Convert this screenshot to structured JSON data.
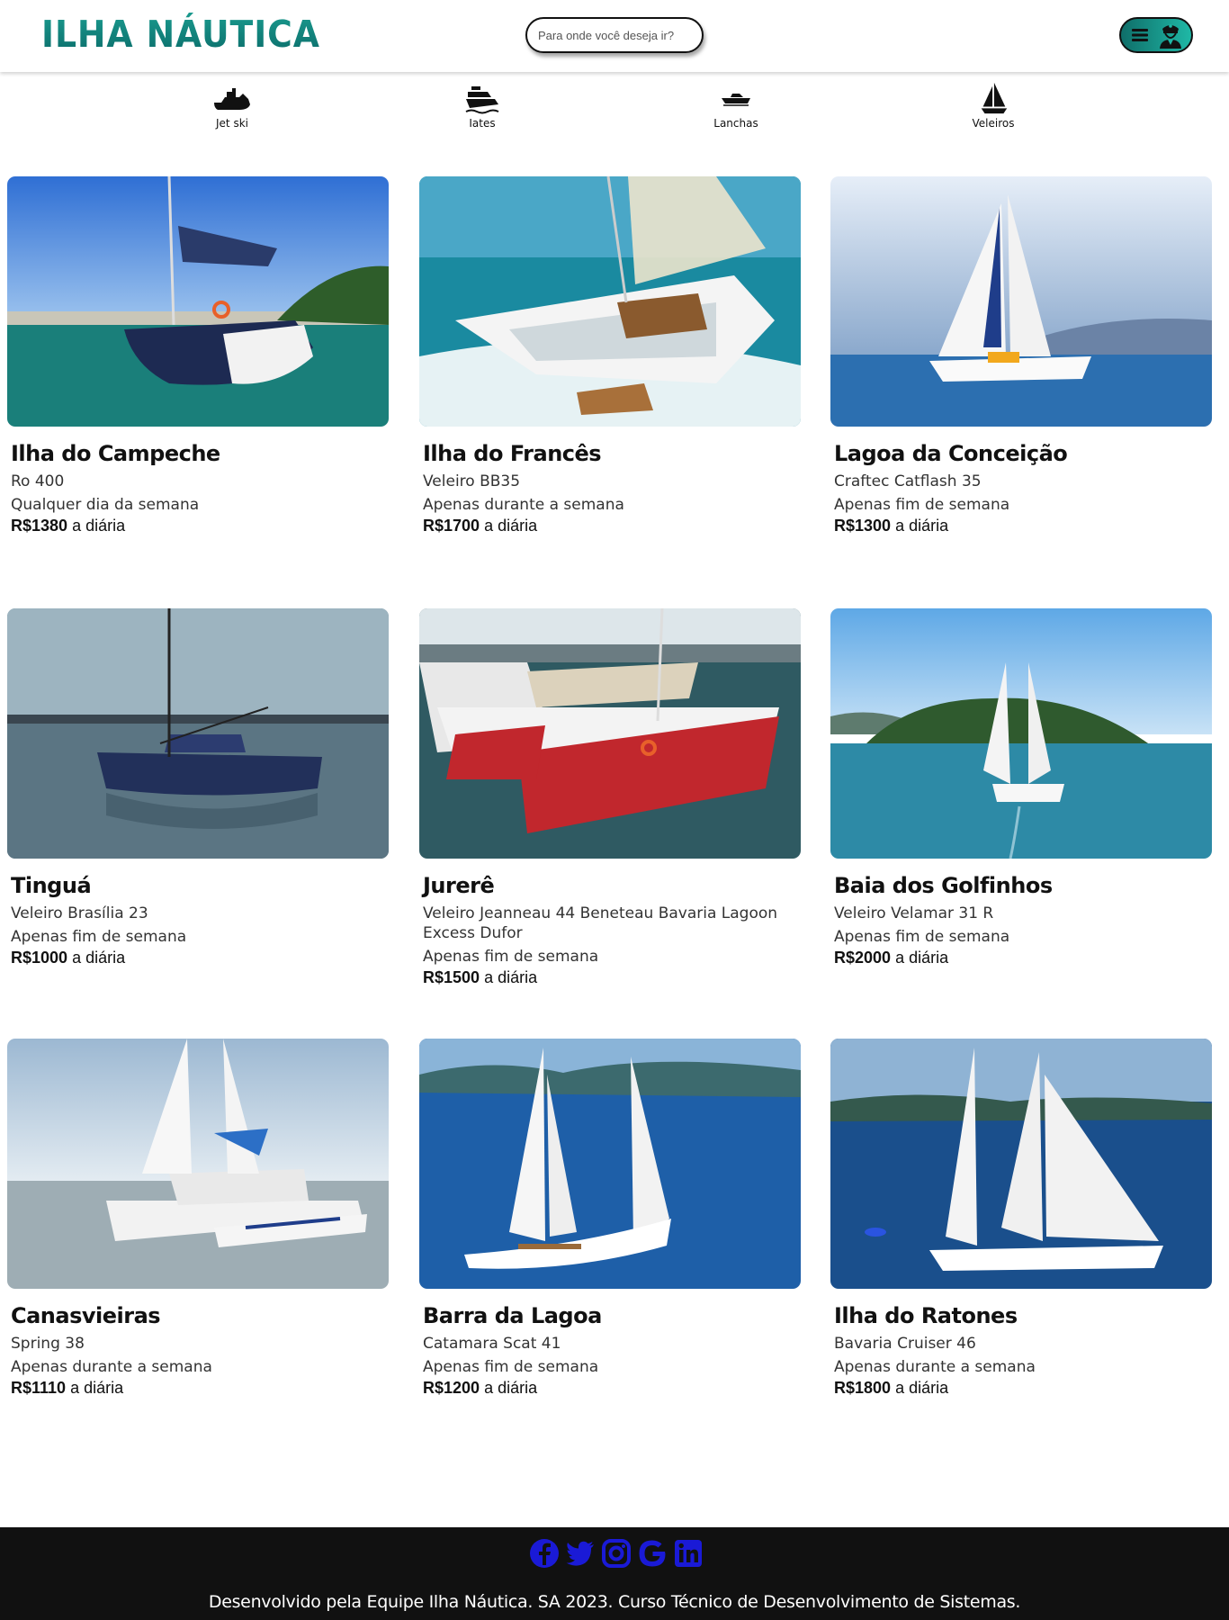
{
  "header": {
    "logo": "ILHA NÁUTICA",
    "search_placeholder": "Para onde você deseja ir?"
  },
  "categories": [
    {
      "label": "Jet ski",
      "icon": "jetski-icon"
    },
    {
      "label": "Iates",
      "icon": "yacht-icon"
    },
    {
      "label": "Lanchas",
      "icon": "speedboat-icon"
    },
    {
      "label": "Veleiros",
      "icon": "sailboat-icon"
    }
  ],
  "cards": [
    {
      "title": "Ilha do Campeche",
      "model": "Ro 400",
      "availability": "Qualquer dia da semana",
      "price": "R$1380",
      "price_suffix": " a diária"
    },
    {
      "title": "Ilha do Francês",
      "model": "Veleiro BB35",
      "availability": "Apenas durante a semana",
      "price": "R$1700",
      "price_suffix": " a diária"
    },
    {
      "title": "Lagoa da Conceição",
      "model": "Craftec Catflash 35",
      "availability": "Apenas fim de semana",
      "price": "R$1300",
      "price_suffix": " a diária"
    },
    {
      "title": "Tinguá",
      "model": "Veleiro Brasília 23",
      "availability": "Apenas fim de semana",
      "price": "R$1000",
      "price_suffix": " a diária"
    },
    {
      "title": "Jurerê",
      "model": "Veleiro Jeanneau 44 Beneteau Bavaria Lagoon Excess Dufor",
      "availability": "Apenas fim de semana",
      "price": "R$1500",
      "price_suffix": " a diária"
    },
    {
      "title": "Baia dos Golfinhos",
      "model": "Veleiro Velamar 31 R",
      "availability": "Apenas fim de semana",
      "price": "R$2000",
      "price_suffix": " a diária"
    },
    {
      "title": "Canasvieiras",
      "model": "Spring 38",
      "availability": "Apenas durante a semana",
      "price": "R$1110",
      "price_suffix": " a diária"
    },
    {
      "title": "Barra da Lagoa",
      "model": "Catamara Scat 41",
      "availability": "Apenas fim de semana",
      "price": "R$1200",
      "price_suffix": " a diária"
    },
    {
      "title": "Ilha do Ratones",
      "model": "Bavaria Cruiser 46",
      "availability": "Apenas durante a semana",
      "price": "R$1800",
      "price_suffix": " a diária"
    }
  ],
  "footer": {
    "social": [
      "facebook-icon",
      "twitter-icon",
      "instagram-icon",
      "google-icon",
      "linkedin-icon"
    ],
    "text": "Desenvolvido pela Equipe Ilha Náutica. SA 2023. Curso Técnico de Desenvolvimento de Sistemas."
  },
  "colors": {
    "brand": "#14857c",
    "footer_bg": "#111111",
    "social_icons": "#1a1ad6"
  }
}
